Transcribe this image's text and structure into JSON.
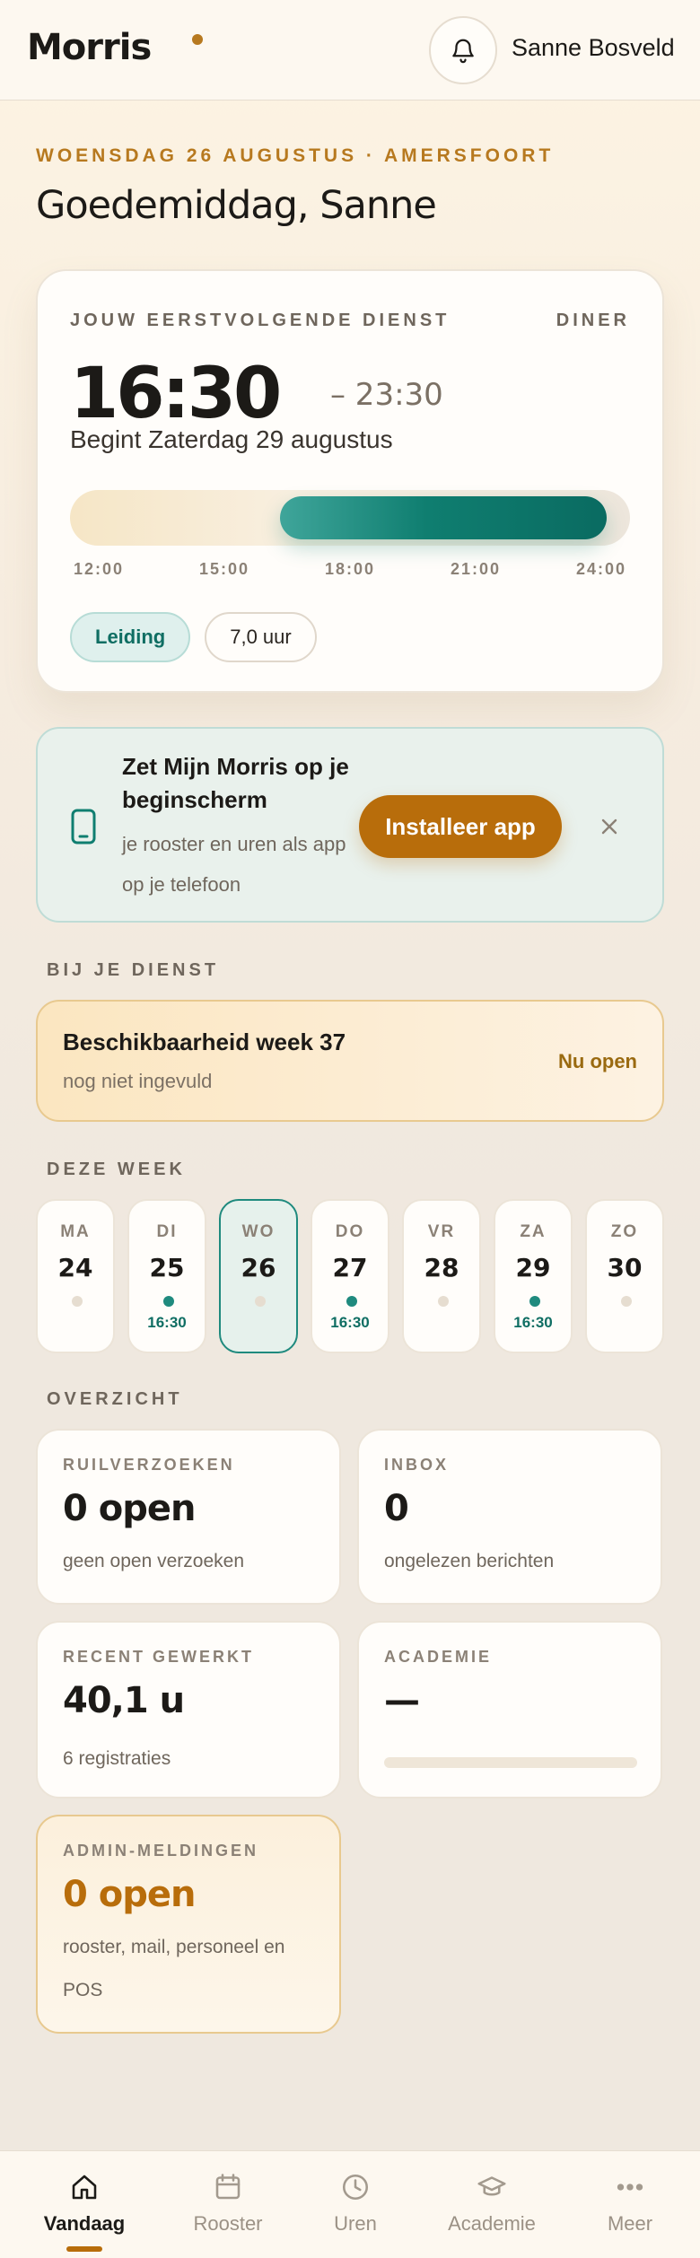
{
  "header": {
    "logo": "Morris",
    "user_name": "Sanne Bosveld",
    "colors": {
      "brand_accent": "#b7791f"
    }
  },
  "greeting": {
    "dateline": "WOENSDAG 26 AUGUSTUS · AMERSFOORT",
    "title": "Goedemiddag, Sanne"
  },
  "next_shift": {
    "label": "JOUW EERSTVOLGENDE DIENST",
    "type": "DINER",
    "start": "16:30",
    "end": "– 23:30",
    "begins": "Begint Zaterdag 29 augustus",
    "timeline": {
      "ticks": [
        "12:00",
        "15:00",
        "18:00",
        "21:00",
        "24:00"
      ],
      "range_hours": [
        12,
        24
      ],
      "shift_hours": [
        16.5,
        23.5
      ]
    },
    "role": "Leiding",
    "hours": "7,0 uur"
  },
  "install_banner": {
    "title": "Zet Mijn Morris op je beginscherm",
    "subtitle": "je rooster en uren als app op je telefoon",
    "button": "Installeer app",
    "close_icon": "close-icon"
  },
  "sections": {
    "at_shift": "BIJ JE DIENST",
    "this_week": "DEZE WEEK",
    "overview": "OVERZICHT"
  },
  "availability": {
    "title": "Beschikbaarheid week 37",
    "subtitle": "nog niet ingevuld",
    "status": "Nu open"
  },
  "week": [
    {
      "name": "MA",
      "num": "24",
      "has_shift": false,
      "time": ""
    },
    {
      "name": "DI",
      "num": "25",
      "has_shift": true,
      "time": "16:30"
    },
    {
      "name": "WO",
      "num": "26",
      "has_shift": false,
      "time": "",
      "today": true
    },
    {
      "name": "DO",
      "num": "27",
      "has_shift": true,
      "time": "16:30"
    },
    {
      "name": "VR",
      "num": "28",
      "has_shift": false,
      "time": ""
    },
    {
      "name": "ZA",
      "num": "29",
      "has_shift": true,
      "time": "16:30"
    },
    {
      "name": "ZO",
      "num": "30",
      "has_shift": false,
      "time": ""
    }
  ],
  "overview": {
    "swaps": {
      "label": "RUILVERZOEKEN",
      "value": "0 open",
      "sub": "geen open verzoeken"
    },
    "inbox": {
      "label": "INBOX",
      "value": "0",
      "sub": "ongelezen berichten"
    },
    "recent": {
      "label": "RECENT GEWERKT",
      "value": "40,1 u",
      "sub": "6 registraties"
    },
    "academy": {
      "label": "ACADEMIE",
      "value": "—",
      "progress": 0
    },
    "admin": {
      "label": "ADMIN-MELDINGEN",
      "value": "0 open",
      "sub": "rooster, mail, personeel en POS"
    }
  },
  "bottom_nav": [
    {
      "label": "Vandaag",
      "icon": "home-icon",
      "active": true
    },
    {
      "label": "Rooster",
      "icon": "calendar-icon",
      "active": false
    },
    {
      "label": "Uren",
      "icon": "clock-icon",
      "active": false
    },
    {
      "label": "Academie",
      "icon": "graduation-cap-icon",
      "active": false
    },
    {
      "label": "Meer",
      "icon": "more-icon",
      "active": false
    }
  ]
}
